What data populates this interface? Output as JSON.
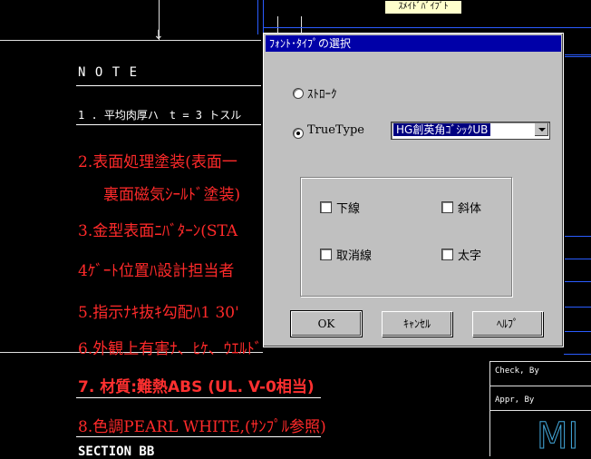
{
  "drawing": {
    "top_tag": "ｽﾒｲﾄﾞﾊﾞｲﾌﾞﾄ",
    "note_title": "N O T E",
    "note_lines": [
      "1 . 平均肉厚ハ　t = 3 トスル",
      "2.表面処理塗装(表面一",
      "裏面磁気ｼｰﾙﾄﾞ塗装)",
      "3.金型表面ﾆﾊﾞﾀｰﾝ(STA",
      "4ｹﾞｰﾄ位置ﾊ設計担当者",
      "5.指示ﾅｷ抜ｷ勾配ﾊ1 30'",
      "6.外観上有害ﾅ、ﾋｹ、ｳｴﾙﾄﾞ",
      "7. 材質:難熱ABS (UL. V-0相当)",
      "8.色調PEARL WHITE,(ｻﾝﾌﾟﾙ参照)"
    ],
    "section_label": "SECTION BB",
    "check_by": "Check, By",
    "appr_by": "Appr, By",
    "corner_text": "MI"
  },
  "dialog": {
    "title": "ﾌｫﾝﾄ･ﾀｲﾌﾟの選択",
    "radio_stroke": "ｽﾄﾛｰｸ",
    "radio_truetype": "TrueType",
    "font_selected": "HG創英角ｺﾞｼｯｸUB",
    "check_underline": "下線",
    "check_italic": "斜体",
    "check_strike": "取消線",
    "check_bold": "太字",
    "ok": "OK",
    "cancel": "ｷｬﾝｾﾙ",
    "help": "ﾍﾙﾌﾟ"
  }
}
